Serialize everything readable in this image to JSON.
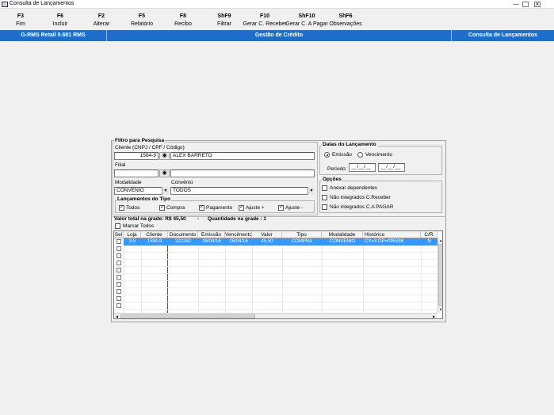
{
  "window": {
    "title": "Consulta de Lançamentos",
    "controls": [
      "minimize",
      "restore",
      "close"
    ]
  },
  "toolbar": [
    {
      "key": "F3",
      "label": "Fim"
    },
    {
      "key": "F6",
      "label": "Incluir"
    },
    {
      "key": "F2",
      "label": "Alterar"
    },
    {
      "key": "F5",
      "label": "Relatório"
    },
    {
      "key": "F8",
      "label": "Recibo"
    },
    {
      "key": "ShF9",
      "label": "Filtrar"
    },
    {
      "key": "F10",
      "label": "Gerar C. Receber"
    },
    {
      "key": "ShF10",
      "label": "Gerar C. A Pagar"
    },
    {
      "key": "ShF6",
      "label": "Observações"
    }
  ],
  "band": {
    "app": "G-RMS Retail 5.681 RMS",
    "module": "Gestão de Crédito",
    "screen": "Consulta de Lançamentos",
    "color": "#1e6fcc"
  },
  "filter": {
    "title": "Filtro para Pesquisa",
    "client_label": "Cliente (CNPJ / CPF / Código)",
    "client_code": "1584-9",
    "client_name": "ALEX BARRETO",
    "filial_label": "Filial",
    "filial_value": "",
    "filial_name": "",
    "modalidade_label": "Modalidade",
    "modalidade_value": "CONVENIO",
    "convenio_label": "Convênio",
    "convenio_value": "TODOS",
    "search_icon": "binoculars-icon"
  },
  "tipos": {
    "title": "Lançamentos do Tipo",
    "items": [
      {
        "label": "Todos",
        "checked": true
      },
      {
        "label": "Compra",
        "checked": true
      },
      {
        "label": "Pagamento",
        "checked": true
      },
      {
        "label": "Ajuste +",
        "checked": true
      },
      {
        "label": "Ajuste -",
        "checked": true
      }
    ]
  },
  "datas": {
    "title": "Datas do Lançamento",
    "emissao_label": "Emissão",
    "vencimento_label": "Vencimento",
    "selected": "Emissão",
    "periodo_label": "Período:",
    "date_start": "__/__/__",
    "date_end": "__/__/__"
  },
  "opcoes": {
    "title": "Opções",
    "items": [
      {
        "label": "Anexar dependentes",
        "checked": false
      },
      {
        "label": "Não integrados C.Receber",
        "checked": false
      },
      {
        "label": "Não integrados C.A PAGAR",
        "checked": false
      }
    ]
  },
  "summary": {
    "total_label": "Valor total na grade: R$ 45,50",
    "separator": "-",
    "qty_label": "Quantidade na grade : 1",
    "marcar_todos": "Marcar Todos"
  },
  "grid": {
    "columns": [
      "Sel",
      "Loja",
      "Cliente",
      "Documento",
      "Emissão",
      "Vencimento",
      "Valor",
      "Tipo",
      "Modalidade",
      "Histórico",
      "C/R"
    ],
    "rows": [
      [
        "",
        "3-5",
        "1584-9",
        "222262",
        "26/04/16",
        "26/04/16",
        "45,50",
        "COMPRA",
        "CONVENIO",
        "CX=3 OP=095336",
        "N"
      ]
    ],
    "empty_rows": 10,
    "selected_row_color": "#3399ff"
  }
}
